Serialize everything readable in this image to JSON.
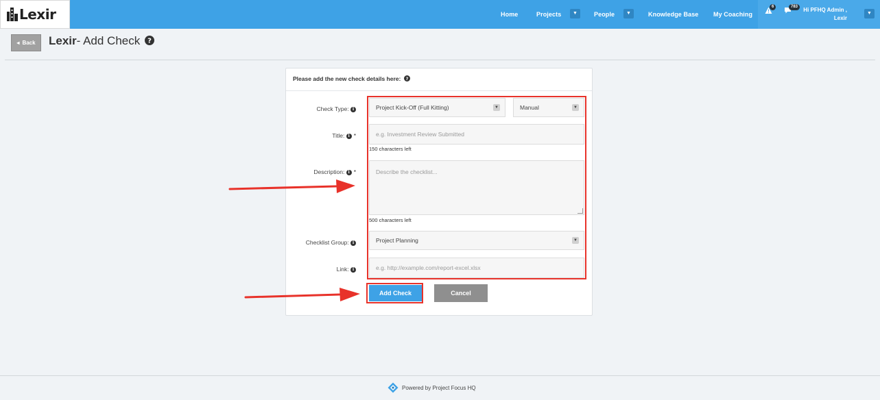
{
  "header": {
    "logo_text": "Lexir",
    "nav": [
      {
        "label": "Home"
      },
      {
        "label": "Projects"
      },
      {
        "label": "People"
      },
      {
        "label": "Knowledge Base"
      },
      {
        "label": "My Coaching"
      }
    ],
    "alerts_count": "6",
    "messages_count": "783",
    "user_greeting": "Hi PFHQ Admin ,",
    "user_org": "Lexir",
    "accent_color": "#3ea2e6"
  },
  "page": {
    "back_label": "Back",
    "title_brand": "Lexir",
    "title_rest": "- Add Check"
  },
  "form": {
    "heading": "Please add the new check details here:",
    "check_type": {
      "label": "Check Type:",
      "value": "Project Kick-Off (Full Kitting)",
      "mode_value": "Manual"
    },
    "title": {
      "label": "Title:",
      "required_mark": "*",
      "placeholder": "e.g. Investment Review Submitted",
      "chars_left": "150 characters left"
    },
    "description": {
      "label": "Description:",
      "required_mark": "*",
      "placeholder": "Describe the checklist...",
      "chars_left": "500 characters left"
    },
    "checklist_group": {
      "label": "Checklist Group:",
      "value": "Project Planning"
    },
    "link": {
      "label": "Link:",
      "placeholder": "e.g. http://example.com/report-excel.xlsx"
    },
    "add_button": "Add Check",
    "cancel_button": "Cancel"
  },
  "footer": {
    "text": "Powered by Project Focus HQ"
  },
  "annotation_color": "#e8322a"
}
